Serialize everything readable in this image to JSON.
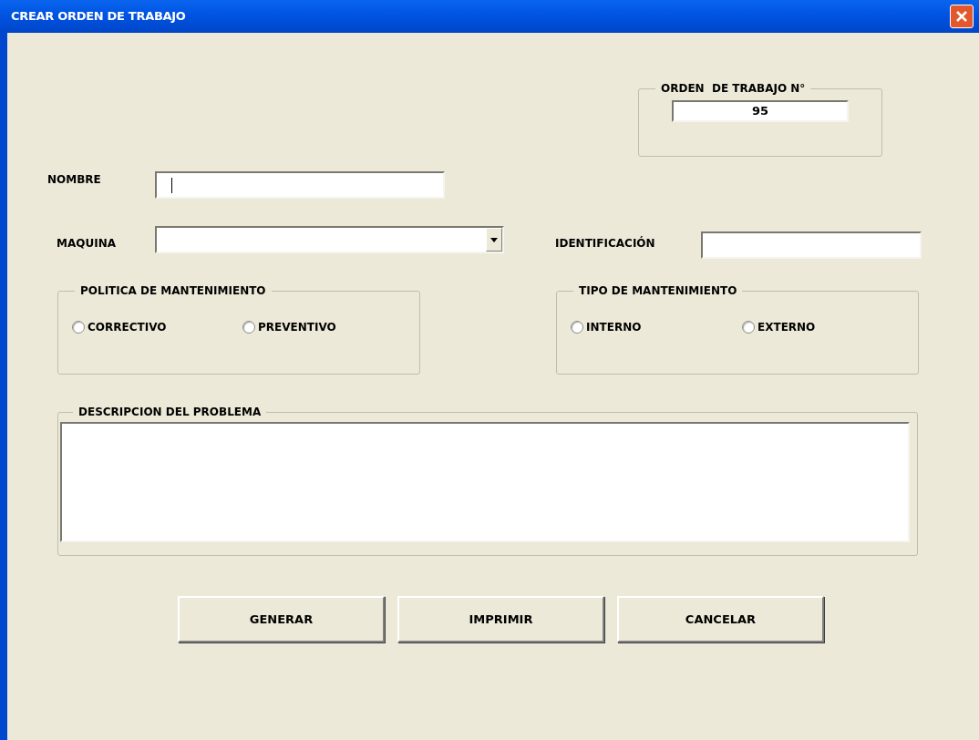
{
  "window": {
    "title": "CREAR ORDEN DE TRABAJO"
  },
  "order_number": {
    "legend": "ORDEN  DE TRABAJO N°",
    "value": "95"
  },
  "nombre": {
    "label": "NOMBRE",
    "focused": true
  },
  "maquina": {
    "label": "MAQUINA"
  },
  "identificacion": {
    "label": "IDENTIFICACIÓN"
  },
  "radio_groups": [
    {
      "legend": "POLITICA DE MANTENIMIENTO",
      "options": [
        {
          "label": "CORRECTIVO",
          "selected": false
        },
        {
          "label": "PREVENTIVO",
          "selected": false
        }
      ]
    },
    {
      "legend": "TIPO DE MANTENIMIENTO",
      "options": [
        {
          "label": "INTERNO",
          "selected": false
        },
        {
          "label": "EXTERNO",
          "selected": false
        }
      ]
    }
  ],
  "description": {
    "legend": "DESCRIPCION DEL PROBLEMA"
  },
  "buttons": [
    "GENERAR",
    "IMPRIMIR",
    "CANCELAR"
  ]
}
